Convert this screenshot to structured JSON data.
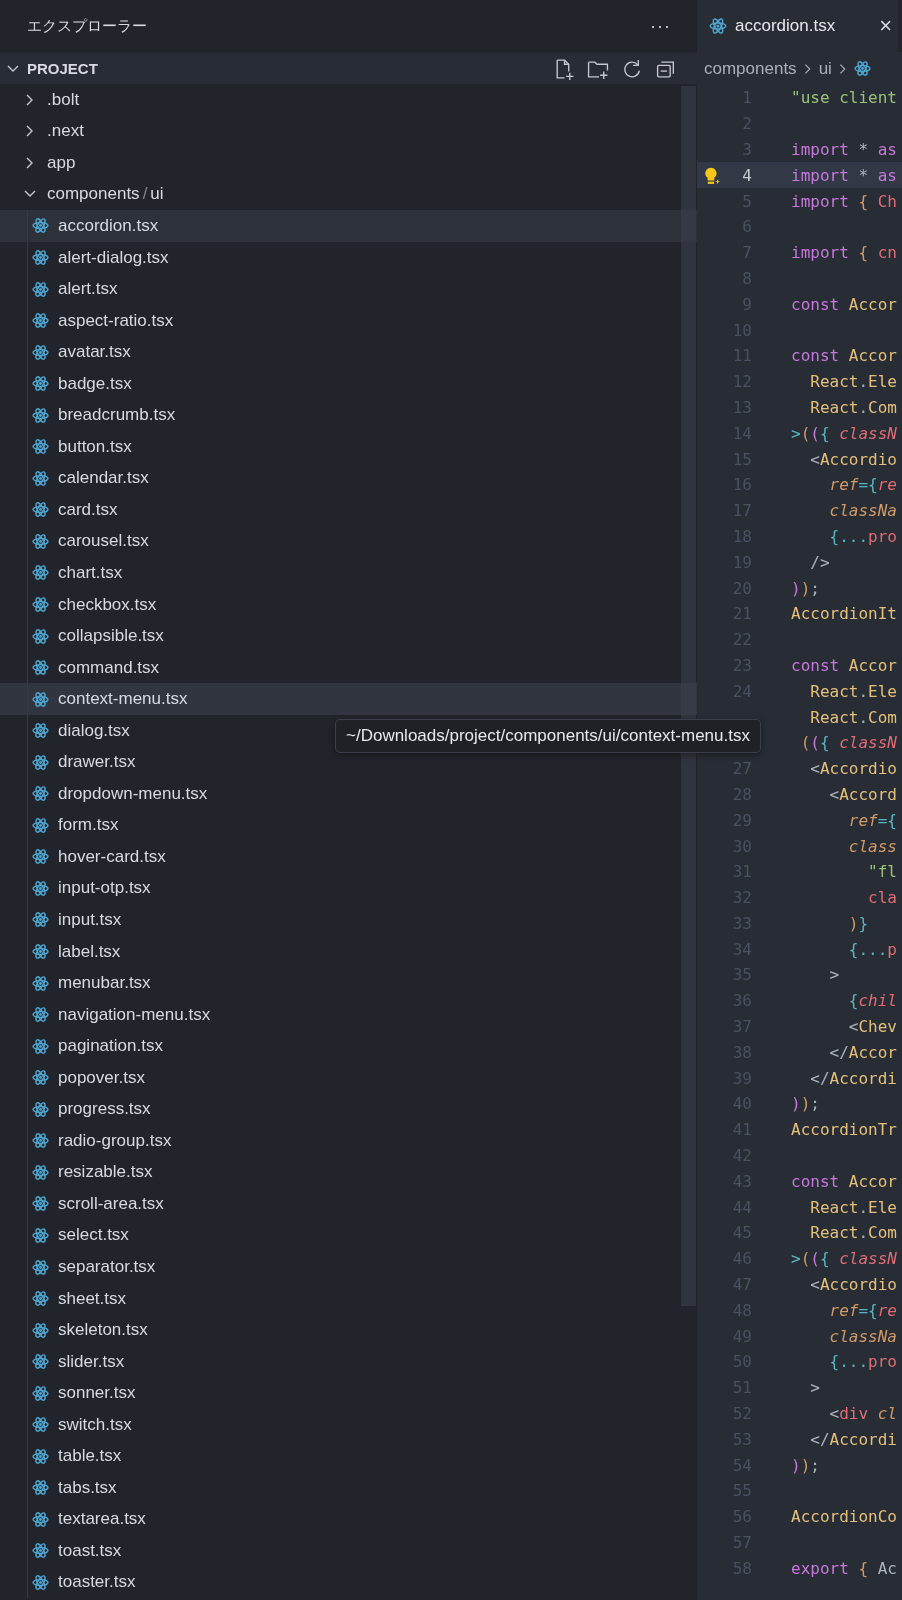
{
  "sidebar": {
    "title": "エクスプローラー",
    "more_button": "···",
    "section": {
      "label": "PROJECT",
      "expanded": true
    },
    "tree": [
      {
        "kind": "folder",
        "label": ".bolt",
        "expanded": false
      },
      {
        "kind": "folder",
        "label": ".next",
        "expanded": false
      },
      {
        "kind": "folder",
        "label": "app",
        "expanded": false
      },
      {
        "kind": "folder",
        "label": "components",
        "separator": "/",
        "suffix": "ui",
        "expanded": true,
        "children": [
          {
            "kind": "file",
            "label": "accordion.tsx",
            "selected": true,
            "hovered": false
          },
          {
            "kind": "file",
            "label": "alert-dialog.tsx",
            "selected": false,
            "hovered": false
          },
          {
            "kind": "file",
            "label": "alert.tsx",
            "selected": false,
            "hovered": false
          },
          {
            "kind": "file",
            "label": "aspect-ratio.tsx",
            "selected": false,
            "hovered": false
          },
          {
            "kind": "file",
            "label": "avatar.tsx",
            "selected": false,
            "hovered": false
          },
          {
            "kind": "file",
            "label": "badge.tsx",
            "selected": false,
            "hovered": false
          },
          {
            "kind": "file",
            "label": "breadcrumb.tsx",
            "selected": false,
            "hovered": false
          },
          {
            "kind": "file",
            "label": "button.tsx",
            "selected": false,
            "hovered": false
          },
          {
            "kind": "file",
            "label": "calendar.tsx",
            "selected": false,
            "hovered": false
          },
          {
            "kind": "file",
            "label": "card.tsx",
            "selected": false,
            "hovered": false
          },
          {
            "kind": "file",
            "label": "carousel.tsx",
            "selected": false,
            "hovered": false
          },
          {
            "kind": "file",
            "label": "chart.tsx",
            "selected": false,
            "hovered": false
          },
          {
            "kind": "file",
            "label": "checkbox.tsx",
            "selected": false,
            "hovered": false
          },
          {
            "kind": "file",
            "label": "collapsible.tsx",
            "selected": false,
            "hovered": false
          },
          {
            "kind": "file",
            "label": "command.tsx",
            "selected": false,
            "hovered": false
          },
          {
            "kind": "file",
            "label": "context-menu.tsx",
            "selected": false,
            "hovered": true
          },
          {
            "kind": "file",
            "label": "dialog.tsx",
            "selected": false,
            "hovered": false
          },
          {
            "kind": "file",
            "label": "drawer.tsx",
            "selected": false,
            "hovered": false
          },
          {
            "kind": "file",
            "label": "dropdown-menu.tsx",
            "selected": false,
            "hovered": false
          },
          {
            "kind": "file",
            "label": "form.tsx",
            "selected": false,
            "hovered": false
          },
          {
            "kind": "file",
            "label": "hover-card.tsx",
            "selected": false,
            "hovered": false
          },
          {
            "kind": "file",
            "label": "input-otp.tsx",
            "selected": false,
            "hovered": false
          },
          {
            "kind": "file",
            "label": "input.tsx",
            "selected": false,
            "hovered": false
          },
          {
            "kind": "file",
            "label": "label.tsx",
            "selected": false,
            "hovered": false
          },
          {
            "kind": "file",
            "label": "menubar.tsx",
            "selected": false,
            "hovered": false
          },
          {
            "kind": "file",
            "label": "navigation-menu.tsx",
            "selected": false,
            "hovered": false
          },
          {
            "kind": "file",
            "label": "pagination.tsx",
            "selected": false,
            "hovered": false
          },
          {
            "kind": "file",
            "label": "popover.tsx",
            "selected": false,
            "hovered": false
          },
          {
            "kind": "file",
            "label": "progress.tsx",
            "selected": false,
            "hovered": false
          },
          {
            "kind": "file",
            "label": "radio-group.tsx",
            "selected": false,
            "hovered": false
          },
          {
            "kind": "file",
            "label": "resizable.tsx",
            "selected": false,
            "hovered": false
          },
          {
            "kind": "file",
            "label": "scroll-area.tsx",
            "selected": false,
            "hovered": false
          },
          {
            "kind": "file",
            "label": "select.tsx",
            "selected": false,
            "hovered": false
          },
          {
            "kind": "file",
            "label": "separator.tsx",
            "selected": false,
            "hovered": false
          },
          {
            "kind": "file",
            "label": "sheet.tsx",
            "selected": false,
            "hovered": false
          },
          {
            "kind": "file",
            "label": "skeleton.tsx",
            "selected": false,
            "hovered": false
          },
          {
            "kind": "file",
            "label": "slider.tsx",
            "selected": false,
            "hovered": false
          },
          {
            "kind": "file",
            "label": "sonner.tsx",
            "selected": false,
            "hovered": false
          },
          {
            "kind": "file",
            "label": "switch.tsx",
            "selected": false,
            "hovered": false
          },
          {
            "kind": "file",
            "label": "table.tsx",
            "selected": false,
            "hovered": false
          },
          {
            "kind": "file",
            "label": "tabs.tsx",
            "selected": false,
            "hovered": false
          },
          {
            "kind": "file",
            "label": "textarea.tsx",
            "selected": false,
            "hovered": false
          },
          {
            "kind": "file",
            "label": "toast.tsx",
            "selected": false,
            "hovered": false
          },
          {
            "kind": "file",
            "label": "toaster.tsx",
            "selected": false,
            "hovered": false
          }
        ]
      }
    ]
  },
  "tooltip": "~/Downloads/project/components/ui/context-menu.tsx",
  "editor": {
    "tabs": [
      {
        "label": "accordion.tsx",
        "close": "×",
        "selected": true
      }
    ],
    "breadcrumb": [
      "components",
      "ui"
    ],
    "lines": [
      {
        "number": "1",
        "active": false,
        "tokens": [
          {
            "kind": "str",
            "text": "\"use client"
          }
        ]
      },
      {
        "number": "2",
        "active": false
      },
      {
        "number": "3",
        "active": false,
        "tokens": [
          {
            "kind": "kw",
            "text": "import"
          },
          {
            "kind": "op",
            "text": " * "
          },
          {
            "kind": "kw",
            "text": "as"
          }
        ]
      },
      {
        "number": "4",
        "active": true,
        "lightbulb": true,
        "tokens": [
          {
            "kind": "kw",
            "text": "import"
          },
          {
            "kind": "op",
            "text": " * "
          },
          {
            "kind": "kw",
            "text": "as"
          }
        ]
      },
      {
        "number": "5",
        "active": false,
        "tokens": [
          {
            "kind": "kw",
            "text": "import"
          },
          {
            "kind": "br1",
            "text": " {"
          },
          {
            "kind": "var",
            "text": " Ch"
          }
        ]
      },
      {
        "number": "6",
        "active": false
      },
      {
        "number": "7",
        "active": false,
        "tokens": [
          {
            "kind": "kw",
            "text": "import"
          },
          {
            "kind": "br1",
            "text": " {"
          },
          {
            "kind": "var",
            "text": " cn"
          }
        ]
      },
      {
        "number": "8",
        "active": false
      },
      {
        "number": "9",
        "active": false,
        "tokens": [
          {
            "kind": "kw",
            "text": "const"
          },
          {
            "kind": "type",
            "text": " Accor"
          }
        ]
      },
      {
        "number": "10",
        "active": false
      },
      {
        "number": "11",
        "active": false,
        "tokens": [
          {
            "kind": "kw",
            "text": "const"
          },
          {
            "kind": "type",
            "text": " Accor"
          }
        ]
      },
      {
        "number": "12",
        "active": false,
        "tokens": [
          {
            "kind": "type",
            "text": "  React"
          },
          {
            "kind": "op",
            "text": "."
          },
          {
            "kind": "type",
            "text": "Ele"
          }
        ]
      },
      {
        "number": "13",
        "active": false,
        "tokens": [
          {
            "kind": "type",
            "text": "  React"
          },
          {
            "kind": "op",
            "text": "."
          },
          {
            "kind": "type",
            "text": "Com"
          }
        ]
      },
      {
        "number": "14",
        "active": false,
        "tokens": [
          {
            "kind": "cyan",
            "text": ">"
          },
          {
            "kind": "br1",
            "text": "("
          },
          {
            "kind": "br2",
            "text": "("
          },
          {
            "kind": "cyan",
            "text": "{"
          },
          {
            "kind": "param",
            "text": " classN"
          }
        ]
      },
      {
        "number": "15",
        "active": false,
        "tokens": [
          {
            "kind": "tag",
            "text": "  <"
          },
          {
            "kind": "type",
            "text": "Accordio"
          }
        ]
      },
      {
        "number": "16",
        "active": false,
        "tokens": [
          {
            "kind": "attr",
            "text": "    ref"
          },
          {
            "kind": "cyan",
            "text": "={"
          },
          {
            "kind": "param",
            "text": "re"
          }
        ]
      },
      {
        "number": "17",
        "active": false,
        "tokens": [
          {
            "kind": "attr",
            "text": "    classNa"
          }
        ]
      },
      {
        "number": "18",
        "active": false,
        "tokens": [
          {
            "kind": "cyan",
            "text": "    {..."
          },
          {
            "kind": "var",
            "text": "pro"
          }
        ]
      },
      {
        "number": "19",
        "active": false,
        "tokens": [
          {
            "kind": "tag",
            "text": "  />"
          }
        ]
      },
      {
        "number": "20",
        "active": false,
        "tokens": [
          {
            "kind": "br2",
            "text": ")"
          },
          {
            "kind": "br1",
            "text": ")"
          },
          {
            "kind": "op",
            "text": ";"
          }
        ]
      },
      {
        "number": "21",
        "active": false,
        "tokens": [
          {
            "kind": "type",
            "text": "AccordionIt"
          }
        ]
      },
      {
        "number": "22",
        "active": false
      },
      {
        "number": "23",
        "active": false,
        "tokens": [
          {
            "kind": "kw",
            "text": "const"
          },
          {
            "kind": "type",
            "text": " Accor"
          }
        ]
      },
      {
        "number": "24",
        "active": false,
        "tokens": [
          {
            "kind": "type",
            "text": "  React"
          },
          {
            "kind": "op",
            "text": "."
          },
          {
            "kind": "type",
            "text": "Ele"
          }
        ]
      },
      {
        "active": false,
        "tokens": [
          {
            "kind": "type",
            "text": "  React"
          },
          {
            "kind": "op",
            "text": "."
          },
          {
            "kind": "type",
            "text": "Com"
          }
        ]
      },
      {
        "active": false,
        "tokens": [
          {
            "kind": "br1",
            "text": " ("
          },
          {
            "kind": "br2",
            "text": "("
          },
          {
            "kind": "cyan",
            "text": "{"
          },
          {
            "kind": "param",
            "text": " classN"
          }
        ]
      },
      {
        "number": "27",
        "active": false,
        "tokens": [
          {
            "kind": "tag",
            "text": "  <"
          },
          {
            "kind": "type",
            "text": "Accordio"
          }
        ]
      },
      {
        "number": "28",
        "active": false,
        "tokens": [
          {
            "kind": "tag",
            "text": "    <"
          },
          {
            "kind": "type",
            "text": "Accord"
          }
        ]
      },
      {
        "number": "29",
        "active": false,
        "tokens": [
          {
            "kind": "attr",
            "text": "      ref"
          },
          {
            "kind": "cyan",
            "text": "={"
          }
        ]
      },
      {
        "number": "30",
        "active": false,
        "tokens": [
          {
            "kind": "attr",
            "text": "      class"
          }
        ]
      },
      {
        "number": "31",
        "active": false,
        "tokens": [
          {
            "kind": "str",
            "text": "        \"fl"
          }
        ]
      },
      {
        "number": "32",
        "active": false,
        "tokens": [
          {
            "kind": "var",
            "text": "        cla"
          }
        ]
      },
      {
        "number": "33",
        "active": false,
        "tokens": [
          {
            "kind": "br1",
            "text": "      )"
          },
          {
            "kind": "cyan",
            "text": "}"
          }
        ]
      },
      {
        "number": "34",
        "active": false,
        "tokens": [
          {
            "kind": "cyan",
            "text": "      {..."
          },
          {
            "kind": "var",
            "text": "p"
          }
        ]
      },
      {
        "number": "35",
        "active": false,
        "tokens": [
          {
            "kind": "tag",
            "text": "    >"
          }
        ]
      },
      {
        "number": "36",
        "active": false,
        "tokens": [
          {
            "kind": "cyan",
            "text": "      {"
          },
          {
            "kind": "param",
            "text": "chil"
          }
        ]
      },
      {
        "number": "37",
        "active": false,
        "tokens": [
          {
            "kind": "tag",
            "text": "      <"
          },
          {
            "kind": "type",
            "text": "Chev"
          }
        ]
      },
      {
        "number": "38",
        "active": false,
        "tokens": [
          {
            "kind": "tag",
            "text": "    </"
          },
          {
            "kind": "type",
            "text": "Accor"
          }
        ]
      },
      {
        "number": "39",
        "active": false,
        "tokens": [
          {
            "kind": "tag",
            "text": "  </"
          },
          {
            "kind": "type",
            "text": "Accordi"
          }
        ]
      },
      {
        "number": "40",
        "active": false,
        "tokens": [
          {
            "kind": "br2",
            "text": ")"
          },
          {
            "kind": "br1",
            "text": ")"
          },
          {
            "kind": "op",
            "text": ";"
          }
        ]
      },
      {
        "number": "41",
        "active": false,
        "tokens": [
          {
            "kind": "type",
            "text": "AccordionTr"
          }
        ]
      },
      {
        "number": "42",
        "active": false
      },
      {
        "number": "43",
        "active": false,
        "tokens": [
          {
            "kind": "kw",
            "text": "const"
          },
          {
            "kind": "type",
            "text": " Accor"
          }
        ]
      },
      {
        "number": "44",
        "active": false,
        "tokens": [
          {
            "kind": "type",
            "text": "  React"
          },
          {
            "kind": "op",
            "text": "."
          },
          {
            "kind": "type",
            "text": "Ele"
          }
        ]
      },
      {
        "number": "45",
        "active": false,
        "tokens": [
          {
            "kind": "type",
            "text": "  React"
          },
          {
            "kind": "op",
            "text": "."
          },
          {
            "kind": "type",
            "text": "Com"
          }
        ]
      },
      {
        "number": "46",
        "active": false,
        "tokens": [
          {
            "kind": "cyan",
            "text": ">"
          },
          {
            "kind": "br1",
            "text": "("
          },
          {
            "kind": "br2",
            "text": "("
          },
          {
            "kind": "cyan",
            "text": "{"
          },
          {
            "kind": "param",
            "text": " classN"
          }
        ]
      },
      {
        "number": "47",
        "active": false,
        "tokens": [
          {
            "kind": "tag",
            "text": "  <"
          },
          {
            "kind": "type",
            "text": "Accordio"
          }
        ]
      },
      {
        "number": "48",
        "active": false,
        "tokens": [
          {
            "kind": "attr",
            "text": "    ref"
          },
          {
            "kind": "cyan",
            "text": "={"
          },
          {
            "kind": "param",
            "text": "re"
          }
        ]
      },
      {
        "number": "49",
        "active": false,
        "tokens": [
          {
            "kind": "attr",
            "text": "    classNa"
          }
        ]
      },
      {
        "number": "50",
        "active": false,
        "tokens": [
          {
            "kind": "cyan",
            "text": "    {..."
          },
          {
            "kind": "var",
            "text": "pro"
          }
        ]
      },
      {
        "number": "51",
        "active": false,
        "tokens": [
          {
            "kind": "tag",
            "text": "  >"
          }
        ]
      },
      {
        "number": "52",
        "active": false,
        "tokens": [
          {
            "kind": "tag",
            "text": "    <"
          },
          {
            "kind": "var",
            "text": "div"
          },
          {
            "kind": "attr",
            "text": " cl"
          }
        ]
      },
      {
        "number": "53",
        "active": false,
        "tokens": [
          {
            "kind": "tag",
            "text": "  </"
          },
          {
            "kind": "type",
            "text": "Accordi"
          }
        ]
      },
      {
        "number": "54",
        "active": false,
        "tokens": [
          {
            "kind": "br2",
            "text": ")"
          },
          {
            "kind": "br1",
            "text": ")"
          },
          {
            "kind": "op",
            "text": ";"
          }
        ]
      },
      {
        "number": "55",
        "active": false
      },
      {
        "number": "56",
        "active": false,
        "tokens": [
          {
            "kind": "type",
            "text": "AccordionCo"
          }
        ]
      },
      {
        "number": "57",
        "active": false
      },
      {
        "number": "58",
        "active": false,
        "tokens": [
          {
            "kind": "kw",
            "text": "export"
          },
          {
            "kind": "br1",
            "text": " {"
          },
          {
            "kind": "op",
            "text": " Ac"
          }
        ]
      }
    ]
  }
}
